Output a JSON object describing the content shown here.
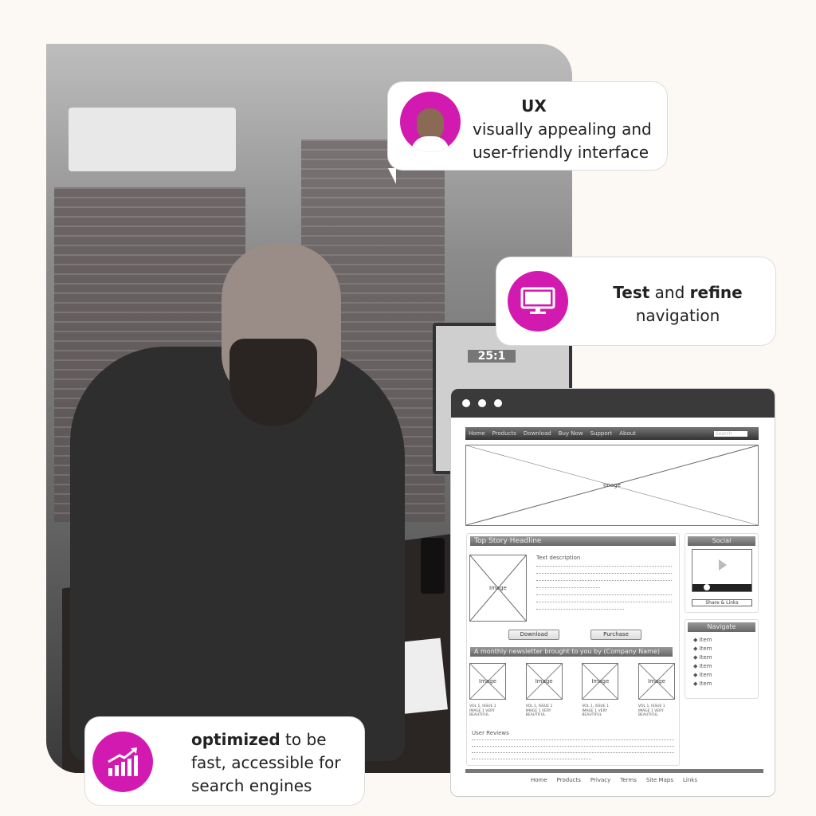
{
  "ux_card": {
    "title": "UX",
    "line1": "visually appealing and",
    "line2": "user-friendly interface",
    "icon": "avatar-photo"
  },
  "test_card": {
    "bold1": "Test",
    "mid": " and ",
    "bold2": "refine",
    "line2": "navigation",
    "icon": "monitor-icon"
  },
  "opt_card": {
    "bold": "optimized",
    "rest": " to be",
    "line2": "fast, accessible for",
    "line3": "search engines",
    "icon": "growth-chart-icon"
  },
  "photo": {
    "monitor_text": "25:1"
  },
  "colors": {
    "accent": "#d21ab0",
    "background": "#fcf8f3",
    "window_bar": "#3a3a3a"
  },
  "wireframe": {
    "nav": [
      "Home",
      "Products",
      "Download",
      "Buy Now",
      "Support",
      "About"
    ],
    "search_placeholder": "Search",
    "hero_label": "Image",
    "top_story": "Top Story Headline",
    "story_image": "Image",
    "text_description": "Text description",
    "download": "Download",
    "purchase": "Purchase",
    "newsletter": "A monthly newsletter brought to you by (Company Name)",
    "thumbs": [
      {
        "label": "Image",
        "caption": "VOL 1, ISSUE 1 IMAGE 1 VERY BEAUTIFUL"
      },
      {
        "label": "Image",
        "caption": "VOL 1, ISSUE 1 IMAGE 1 VERY BEAUTIFUL"
      },
      {
        "label": "Image",
        "caption": "VOL 1, ISSUE 1 IMAGE 1 VERY BEAUTIFUL"
      },
      {
        "label": "Image",
        "caption": "VOL 1, ISSUE 1 IMAGE 1 VERY BEAUTIFUL"
      }
    ],
    "user_reviews": "User Reviews",
    "social": "Social",
    "share_links": "Share & Links",
    "navigate": "Navigate",
    "nav_items": [
      "Item",
      "Item",
      "Item",
      "Item",
      "Item",
      "Item"
    ],
    "footer": [
      "Home",
      "Products",
      "Privacy",
      "Terms",
      "Site Maps",
      "Links"
    ]
  }
}
